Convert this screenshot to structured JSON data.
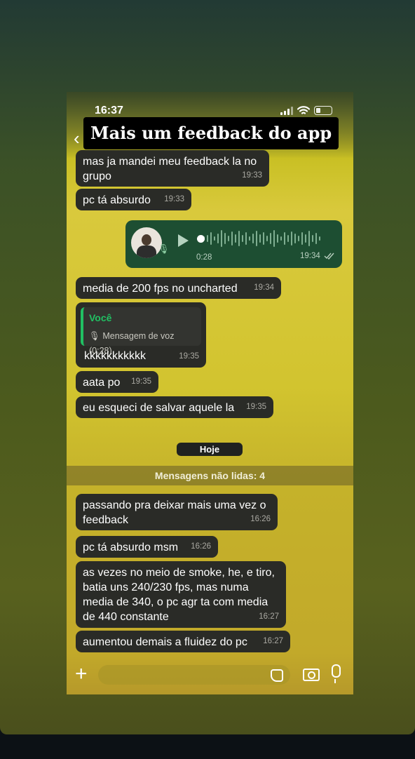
{
  "overlay": {
    "title": "Mais um feedback do app"
  },
  "status": {
    "time": "16:37"
  },
  "chat": {
    "messages": [
      {
        "text": "mas ja mandei meu feedback la no grupo",
        "time": "19:33"
      },
      {
        "text": "pc tá absurdo",
        "time": "19:33"
      },
      {
        "text": "media de 200 fps no uncharted",
        "time": "19:34"
      },
      {
        "reply_name": "Você",
        "reply_text": "Mensagem de voz (0:28)",
        "text": "kkkkkkkkkkk",
        "time": "19:35"
      },
      {
        "text": "aata po",
        "time": "19:35"
      },
      {
        "text": "eu esqueci de salvar aquele la",
        "time": "19:35"
      },
      {
        "text": "passando pra deixar mais uma vez o feedback",
        "time": "16:26"
      },
      {
        "text": "pc tá absurdo msm",
        "time": "16:26"
      },
      {
        "text": "as vezes no meio de smoke, he, e tiro, batia uns 240/230 fps, mas numa media de 340, o pc agr ta com media de 440 constante",
        "time": "16:27"
      },
      {
        "text": "aumentou demais a fluidez do pc",
        "time": "16:27"
      }
    ],
    "voice": {
      "duration": "0:28",
      "time": "19:34",
      "status_icon": "double-check-icon"
    },
    "date_label": "Hoje",
    "unread_label": "Mensagens não lidas: 4"
  },
  "colors": {
    "accent": "#21c063",
    "bubble": "#2a2b27",
    "outgoing": "#1d4e32"
  }
}
